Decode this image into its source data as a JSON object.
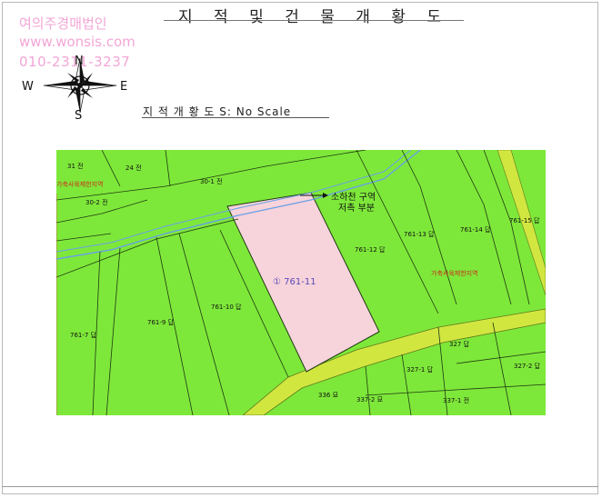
{
  "document": {
    "title": "지 적 및 건 물 개 황 도",
    "subtitle": "지 적 개 황 도 S: No Scale"
  },
  "watermark": {
    "company": "여의주경매법인",
    "website": "www.wonsis.com",
    "phone": "010-2311-3237"
  },
  "compass": {
    "n": "N",
    "s": "S",
    "e": "E",
    "w": "W"
  },
  "map": {
    "subject_parcel": "① 761-11",
    "zone_label_line1": "소하천 구역",
    "zone_label_line2": "저촉 부분",
    "parcels": {
      "p31": "31 전",
      "p24": "24 전",
      "p30_1": "30-1 전",
      "p30_2": "30-2 전",
      "p761_13": "761-13 답",
      "p761_14": "761-14 답",
      "p761_15": "761-15 답",
      "p761_12": "761-12 답",
      "p761_10": "761-10 답",
      "p761_9": "761-9 답",
      "p761_7": "761-7 답",
      "p327": "327 답",
      "p327_1": "327-1 답",
      "p327_2": "327-2 답",
      "p336": "336 묘",
      "p337_2": "337-2 묘",
      "p337_1": "337-1 전"
    },
    "red_labels": {
      "r1": "가축사육제한지역",
      "r2": "가축사육제한지역"
    },
    "colors": {
      "land": "#7ee83a",
      "road": "#d2e640",
      "subject": "#f7d3db",
      "stream": "#6aa0e6",
      "boundary": "#1f3a12",
      "red_text": "#cc2b1a"
    }
  }
}
